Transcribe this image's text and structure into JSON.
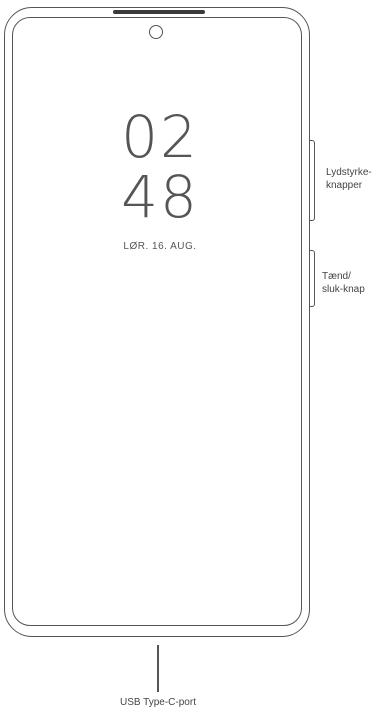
{
  "lockscreen": {
    "hours": "02",
    "minutes": "48",
    "date": "LØR. 16. AUG."
  },
  "callouts": {
    "volume_label": "Lydstyrke-\nknapper",
    "power_label": "Tænd/\nsluk-knap",
    "usb_label": "USB Type-C-port"
  }
}
